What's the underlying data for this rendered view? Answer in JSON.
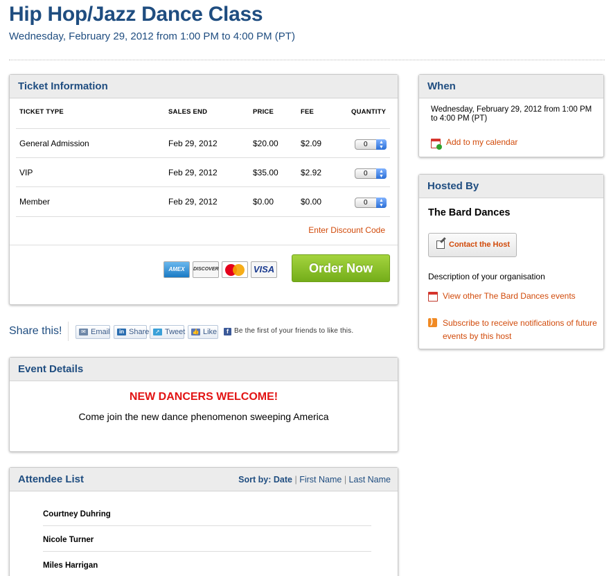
{
  "event": {
    "title": "Hip Hop/Jazz Dance Class",
    "subtitle": "Wednesday, February 29, 2012 from 1:00 PM to 4:00 PM (PT)"
  },
  "ticket": {
    "heading": "Ticket Information",
    "columns": [
      "TICKET TYPE",
      "SALES END",
      "PRICE",
      "FEE",
      "QUANTITY"
    ],
    "rows": [
      {
        "type": "General Admission",
        "sales_end": "Feb 29, 2012",
        "price": "$20.00",
        "fee": "$2.09",
        "quantity": "0"
      },
      {
        "type": "VIP",
        "sales_end": "Feb 29, 2012",
        "price": "$35.00",
        "fee": "$2.92",
        "quantity": "0"
      },
      {
        "type": "Member",
        "sales_end": "Feb 29, 2012",
        "price": "$0.00",
        "fee": "$0.00",
        "quantity": "0"
      }
    ],
    "discount_link": "Enter Discount Code",
    "cards": [
      "AMEX",
      "DISCOVER",
      "MasterCard",
      "VISA"
    ],
    "order_button": "Order Now"
  },
  "share": {
    "label": "Share this!",
    "buttons": {
      "email": "Email",
      "share": "Share",
      "tweet": "Tweet",
      "like": "Like"
    },
    "fb_text": "Be the first of your friends to like this."
  },
  "details": {
    "heading": "Event Details",
    "welcome": "NEW DANCERS WELCOME!",
    "body": "Come join the new dance phenomenon sweeping America"
  },
  "attendees": {
    "heading": "Attendee List",
    "sort_label": "Sort by:",
    "sort_options": [
      "Date",
      "First Name",
      "Last Name"
    ],
    "names": [
      "Courtney Duhring",
      "Nicole Turner",
      "Miles Harrigan"
    ]
  },
  "when": {
    "heading": "When",
    "text": "Wednesday, February 29, 2012 from 1:00 PM to 4:00 PM (PT)",
    "calendar_link": "Add to my calendar"
  },
  "host": {
    "heading": "Hosted By",
    "name": "The Bard Dances",
    "contact_button": "Contact the Host",
    "description": "Description of your organisation",
    "other_events_link": "View other The Bard Dances events",
    "subscribe_link": "Subscribe to receive notifications of future events by this host"
  },
  "colors": {
    "title_blue": "#1f4d80",
    "link_orange": "#d14a0a",
    "order_green": "#8dc22a",
    "welcome_red": "#e21313"
  }
}
